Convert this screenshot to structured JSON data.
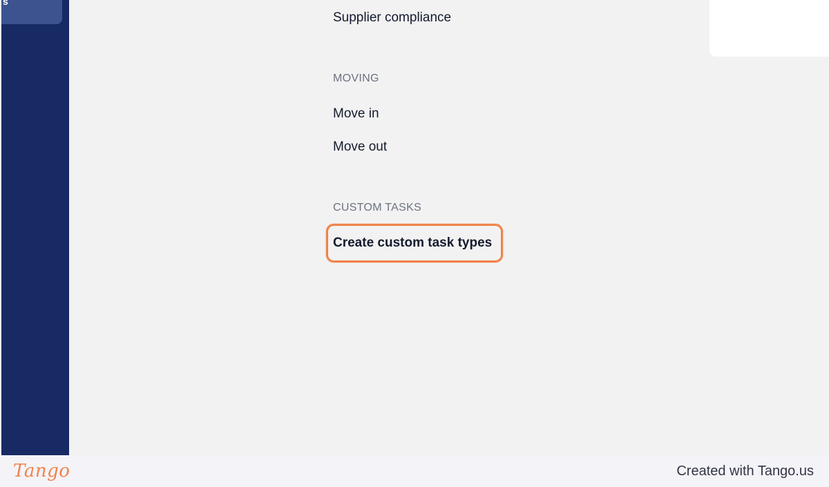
{
  "sidebar": {
    "tab_text": "s",
    "colors": {
      "background": "#172a63",
      "tab": "#3c538f"
    }
  },
  "menu": {
    "items_top": [
      {
        "label": "Supplier compliance"
      }
    ],
    "sections": [
      {
        "heading": "MOVING",
        "items": [
          {
            "label": "Move in"
          },
          {
            "label": "Move out"
          }
        ]
      },
      {
        "heading": "CUSTOM TASKS",
        "items": [
          {
            "label": "Create custom task types",
            "highlighted": true
          }
        ]
      }
    ]
  },
  "footer": {
    "logo": "Tango",
    "credit": "Created with Tango.us"
  },
  "colors": {
    "page_background": "#f2f2f2",
    "highlight_border": "#f0834b",
    "text_primary": "#141b2d",
    "text_secondary": "#6b7280"
  }
}
